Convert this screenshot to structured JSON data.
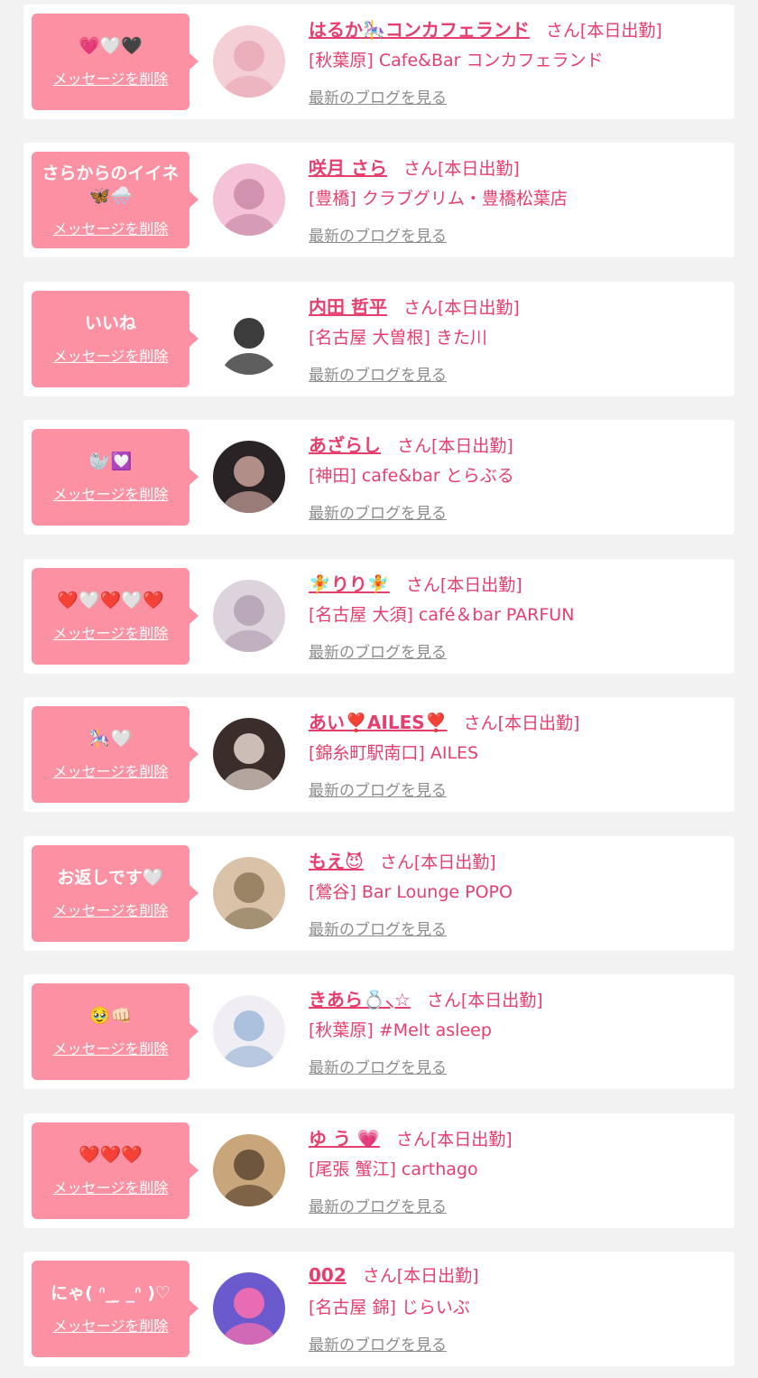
{
  "labels": {
    "delete": "メッセージを削除",
    "san": "さん",
    "status": "[本日出勤]",
    "blog": "最新のブログを見る"
  },
  "items": [
    {
      "message": "💗🤍🖤",
      "name": "はるか🎠コンカフェランド",
      "shop": "[秋葉原] Cafe&Bar コンカフェランド",
      "avatar_colors": [
        "#f4cfd6",
        "#e9a9b6"
      ]
    },
    {
      "message": "さらからのイイネ🦋🌨️",
      "name": "咲月 さら",
      "shop": "[豊橋] クラブグリム・豊橋松葉店",
      "avatar_colors": [
        "#f5c3d7",
        "#c98aa8"
      ]
    },
    {
      "message": "いいね",
      "name": "内田 哲平",
      "shop": "[名古屋 大曽根] きた川",
      "avatar_colors": [
        "#ffffff",
        "#1a1a1a"
      ]
    },
    {
      "message": "🦭💟",
      "name": "あざらし",
      "shop": "[神田] cafe&bar とらぶる",
      "avatar_colors": [
        "#2a2326",
        "#c9a29a"
      ]
    },
    {
      "message": "❤️🤍❤️🤍❤️",
      "name": "🧚りり🧚",
      "shop": "[名古屋 大須] café＆bar PARFUN",
      "avatar_colors": [
        "#ddd3dc",
        "#b3a1b4"
      ]
    },
    {
      "message": "🎠🤍",
      "name": "あい❣️AILES❣️",
      "shop": "[錦糸町駅南口] AILES",
      "avatar_colors": [
        "#3a2d2a",
        "#e7d7d0"
      ]
    },
    {
      "message": "お返しです🤍",
      "name": "もえ😈",
      "shop": "[鶯谷] Bar Lounge POPO",
      "avatar_colors": [
        "#d9c2a8",
        "#8d7a5b"
      ]
    },
    {
      "message": "🥹👊🏻",
      "name": "きあら💍⸜☆",
      "shop": "[秋葉原] #Melt asleep",
      "avatar_colors": [
        "#f0eef4",
        "#9fb8d8"
      ]
    },
    {
      "message": "❤️❤️❤️",
      "name": "ゆ う 💗",
      "shop": "[尾張 蟹江] carthago",
      "avatar_colors": [
        "#c8a57a",
        "#5e4732"
      ]
    },
    {
      "message": "にゃ( ᐢ_ ̫ _ᐢ )♡",
      "name": "002",
      "shop": "[名古屋 錦] じらいぶ",
      "avatar_colors": [
        "#6a5acd",
        "#ff6fae"
      ]
    }
  ]
}
